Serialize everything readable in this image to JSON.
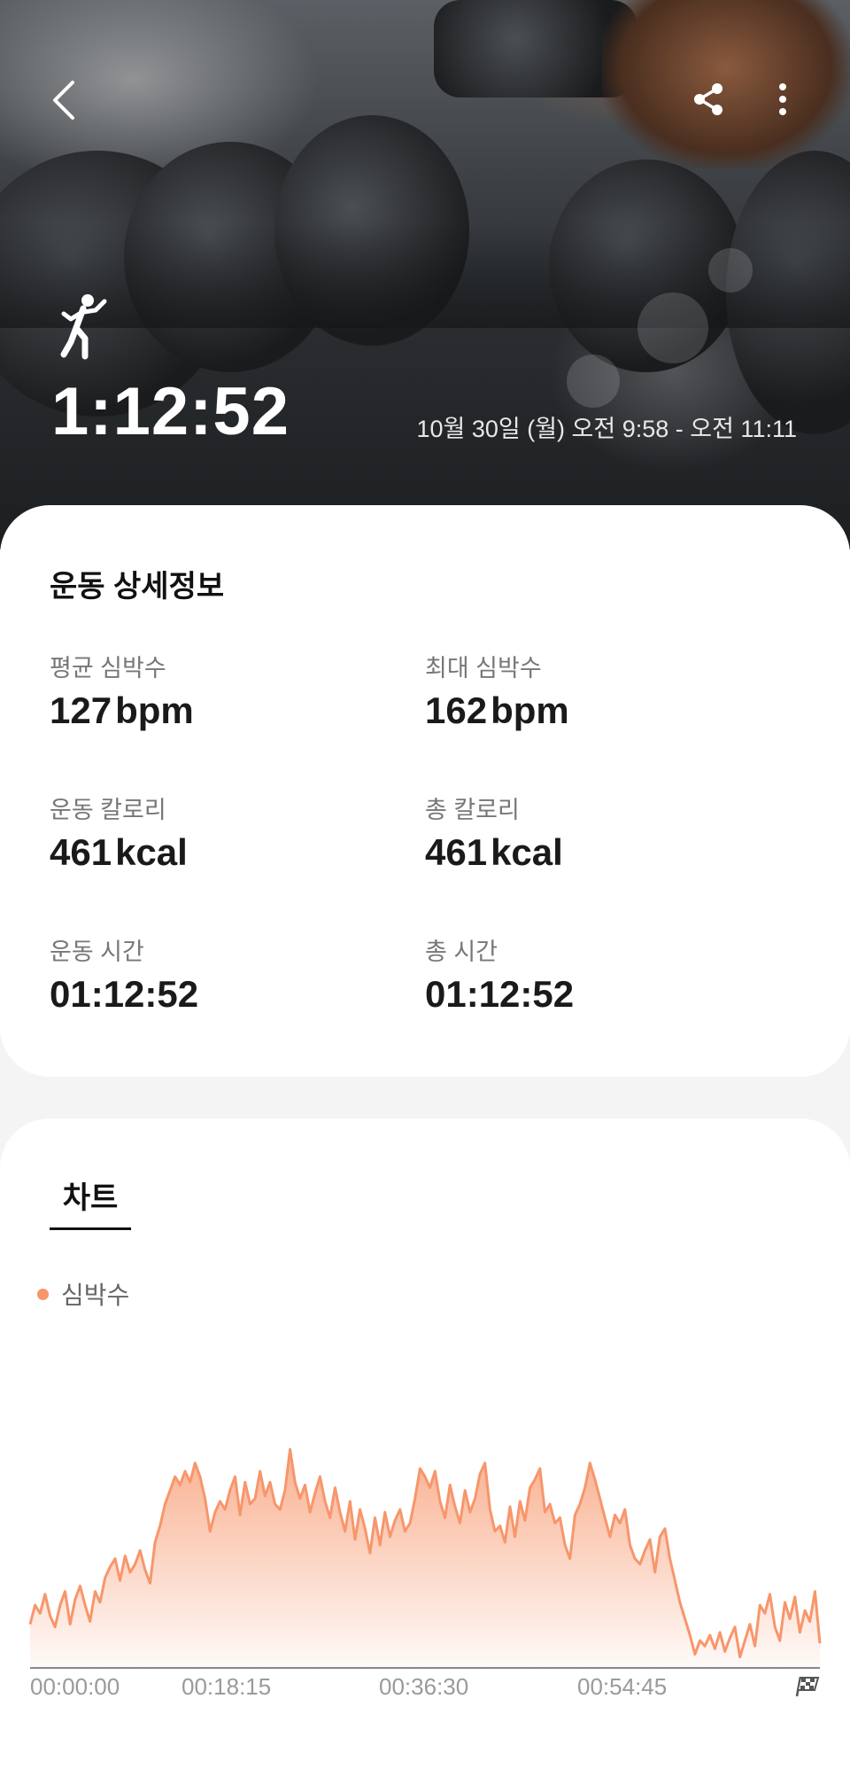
{
  "header": {
    "workout_icon": "person-exercise-icon",
    "duration": "1:12:52",
    "date_range": "10월 30일 (월) 오전 9:58 - 오전 11:11",
    "icons": {
      "back": "chevron-left-icon",
      "share": "share-icon",
      "more": "more-vertical-icon"
    }
  },
  "detail": {
    "title": "운동 상세정보",
    "metrics": [
      {
        "label": "평균 심박수",
        "value": "127",
        "unit": "bpm"
      },
      {
        "label": "최대 심박수",
        "value": "162",
        "unit": "bpm"
      },
      {
        "label": "운동 칼로리",
        "value": "461",
        "unit": "kcal"
      },
      {
        "label": "총 칼로리",
        "value": "461",
        "unit": "kcal"
      },
      {
        "label": "운동 시간",
        "value": "01:12:52",
        "unit": ""
      },
      {
        "label": "총 시간",
        "value": "01:12:52",
        "unit": ""
      }
    ]
  },
  "chart_section": {
    "tab_label": "차트",
    "legend_label": "심박수",
    "accent_color": "#f7966b",
    "end_icon": "finish-flag-icon"
  },
  "chart_data": {
    "type": "area",
    "series": [
      {
        "name": "심박수",
        "values": [
          96,
          103,
          100,
          107,
          99,
          95,
          103,
          108,
          96,
          105,
          110,
          103,
          97,
          108,
          104,
          113,
          117,
          120,
          112,
          121,
          115,
          118,
          123,
          116,
          111,
          126,
          132,
          140,
          145,
          150,
          147,
          152,
          148,
          155,
          150,
          142,
          130,
          137,
          141,
          138,
          145,
          150,
          136,
          148,
          140,
          142,
          152,
          143,
          148,
          140,
          138,
          145,
          160,
          148,
          142,
          147,
          137,
          144,
          150,
          141,
          135,
          146,
          137,
          130,
          141,
          127,
          138,
          131,
          122,
          135,
          125,
          137,
          128,
          134,
          138,
          130,
          133,
          142,
          153,
          150,
          146,
          152,
          141,
          135,
          147,
          139,
          133,
          145,
          137,
          142,
          151,
          155,
          138,
          130,
          132,
          126,
          139,
          128,
          141,
          134,
          146,
          149,
          153,
          137,
          140,
          133,
          135,
          125,
          120,
          136,
          140,
          146,
          155,
          149,
          142,
          135,
          128,
          136,
          133,
          138,
          125,
          120,
          118,
          123,
          127,
          115,
          128,
          131,
          120,
          112,
          104,
          98,
          92,
          85,
          90,
          88,
          92,
          87,
          93,
          86,
          91,
          95,
          84,
          90,
          96,
          88,
          103,
          100,
          107,
          95,
          90,
          104,
          98,
          106,
          93,
          101,
          97,
          108,
          89
        ]
      }
    ],
    "x_ticks": [
      "00:00:00",
      "00:18:15",
      "00:36:30",
      "00:54:45"
    ],
    "xlabel": "",
    "ylabel": "",
    "ylim": [
      80,
      165
    ],
    "grid": false,
    "legend": "top-left"
  }
}
